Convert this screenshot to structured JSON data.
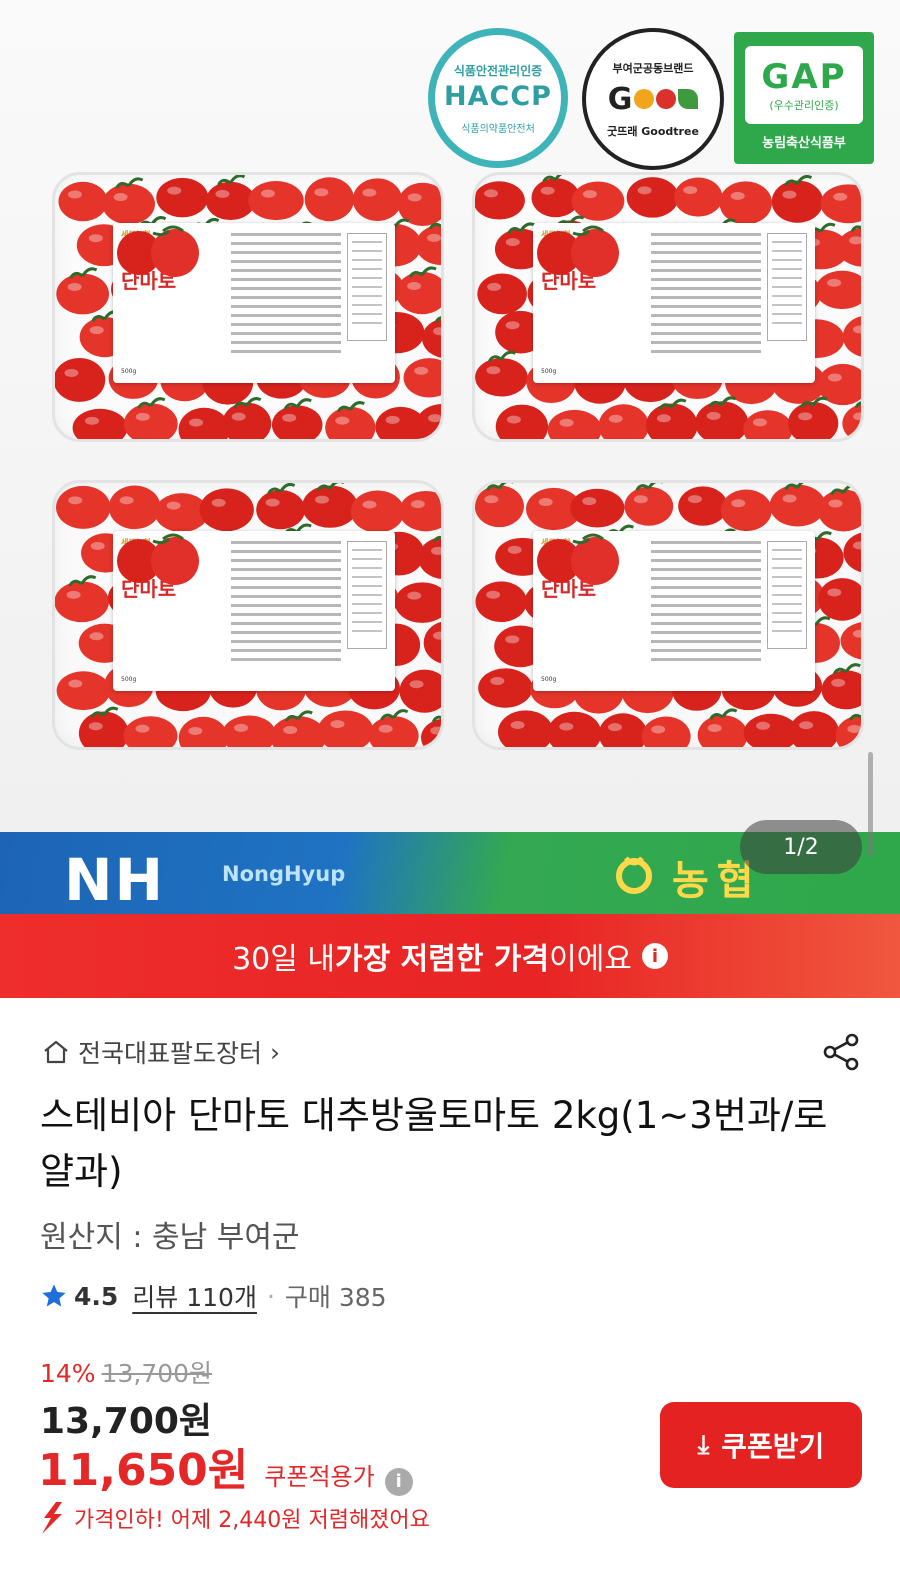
{
  "certs": {
    "haccp_top": "식품안전관리인증",
    "haccp_main": "HACCP",
    "haccp_bottom": "식품의약품안전처",
    "goodtree_top": "부여군공동브랜드",
    "goodtree_main": "G",
    "goodtree_bottom": "굿뜨래 Goodtree",
    "gap_main": "GAP",
    "gap_sub": "(우수관리인증)",
    "gap_bottom": "농림축산식품부"
  },
  "package_label": {
    "brand": "세도농협",
    "title_line1": "스테비아",
    "title_line2": "단마토",
    "footer": "500g"
  },
  "banner": {
    "logo": "NH",
    "wordmark": "NongHyup",
    "korean": "농협",
    "pager": "1/2"
  },
  "price_strip": {
    "prefix": "30일 내 ",
    "highlight": "가장 저렴한 가격",
    "suffix": "이에요",
    "info_glyph": "i"
  },
  "product": {
    "store": "전국대표팔도장터",
    "store_chevron": "›",
    "title": "스테비아 단마토 대추방울토마토 2kg(1~3번과/로얄과)",
    "origin": "원산지 : 충남 부여군",
    "rating": "4.5",
    "review_label": "리뷰 110개",
    "separator": "·",
    "purchase_label": "구매 385"
  },
  "pricing": {
    "discount_rate": "14%",
    "original_price": "13,700원",
    "price": "13,700원",
    "coupon_price": "11,650원",
    "coupon_label": "쿠폰적용가",
    "info_glyph": "i",
    "drop_text": "가격인하! 어제 2,440원 저렴해졌어요",
    "coupon_button": "쿠폰받기",
    "download_glyph": "⤓"
  },
  "colors": {
    "accent_red": "#e52727",
    "nh_blue": "#1e6fbd",
    "nh_green": "#2ea84a",
    "star_blue": "#1e6fd9"
  }
}
